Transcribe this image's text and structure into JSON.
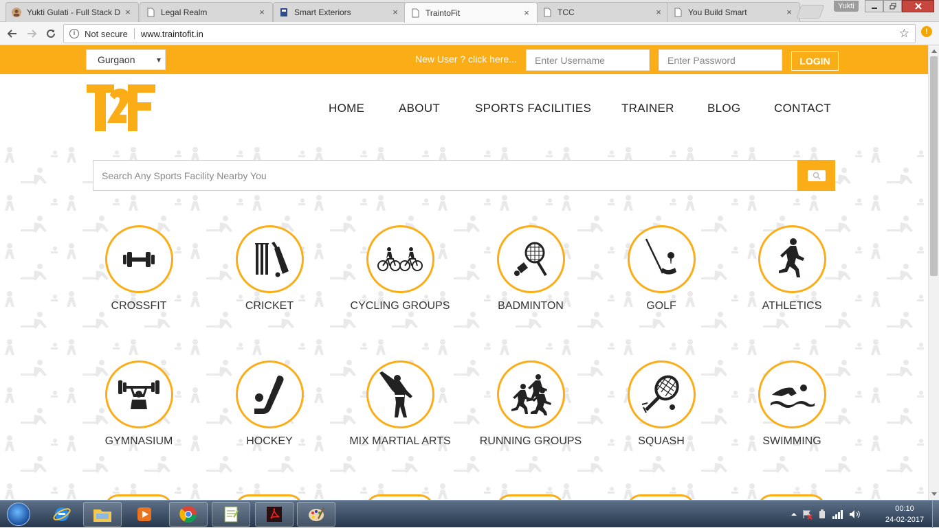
{
  "browser": {
    "tabs": [
      {
        "title": "Yukti Gulati - Full Stack D",
        "active": false
      },
      {
        "title": "Legal Realm",
        "active": false
      },
      {
        "title": "Smart Exteriors",
        "active": false
      },
      {
        "title": "TraintoFit",
        "active": true
      },
      {
        "title": "TCC",
        "active": false
      },
      {
        "title": "You Build Smart",
        "active": false
      }
    ],
    "close_glyph": "×",
    "profile_name": "Yukti",
    "security_label": "Not secure",
    "url": "www.traintofit.in"
  },
  "site": {
    "city_select": "Gurgaon",
    "new_user_link": "New User ? click here...",
    "username_placeholder": "Enter Username",
    "password_placeholder": "Enter Password",
    "login_label": "LOGIN",
    "nav": [
      "HOME",
      "ABOUT",
      "SPORTS FACILITIES",
      "TRAINER",
      "BLOG",
      "CONTACT"
    ],
    "search_placeholder": "Search Any Sports Facility Nearby You",
    "brand_color": "#fbad18",
    "categories": [
      {
        "label": "CROSSFIT",
        "icon": "dumbbell-icon"
      },
      {
        "label": "CRICKET",
        "icon": "cricket-bat-icon"
      },
      {
        "label": "CYCLING GROUPS",
        "icon": "cycling-icon"
      },
      {
        "label": "BADMINTON",
        "icon": "badminton-racket-icon"
      },
      {
        "label": "GOLF",
        "icon": "golf-club-icon"
      },
      {
        "label": "ATHLETICS",
        "icon": "runner-icon"
      },
      {
        "label": "GYMNASIUM",
        "icon": "weightlifter-icon"
      },
      {
        "label": "HOCKEY",
        "icon": "hockey-stick-icon"
      },
      {
        "label": "MIX MARTIAL ARTS",
        "icon": "martial-arts-kick-icon"
      },
      {
        "label": "RUNNING GROUPS",
        "icon": "running-group-icon"
      },
      {
        "label": "SQUASH",
        "icon": "squash-racket-icon"
      },
      {
        "label": "SWIMMING",
        "icon": "swimmer-icon"
      }
    ]
  },
  "taskbar": {
    "time": "00:10",
    "date": "24-02-2017"
  }
}
